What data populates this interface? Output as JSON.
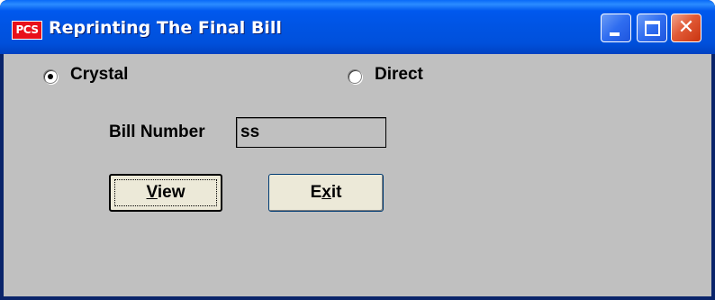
{
  "window": {
    "title": "Reprinting The Final Bill",
    "app_icon_text": "PCS",
    "close_glyph": "✕"
  },
  "options": {
    "crystal_label": "Crystal",
    "crystal_selected": true,
    "direct_label": "Direct",
    "direct_selected": false
  },
  "form": {
    "bill_number_label": "Bill Number",
    "bill_number_value": "ss"
  },
  "buttons": {
    "view_accel": "V",
    "view_rest": "iew",
    "exit_start": "E",
    "exit_accel": "x",
    "exit_rest": "it"
  },
  "colors": {
    "titlebar": "#0054e3",
    "client_bg": "#c0c0c0",
    "close_button": "#e15a36",
    "button_face": "#ece9d8"
  }
}
